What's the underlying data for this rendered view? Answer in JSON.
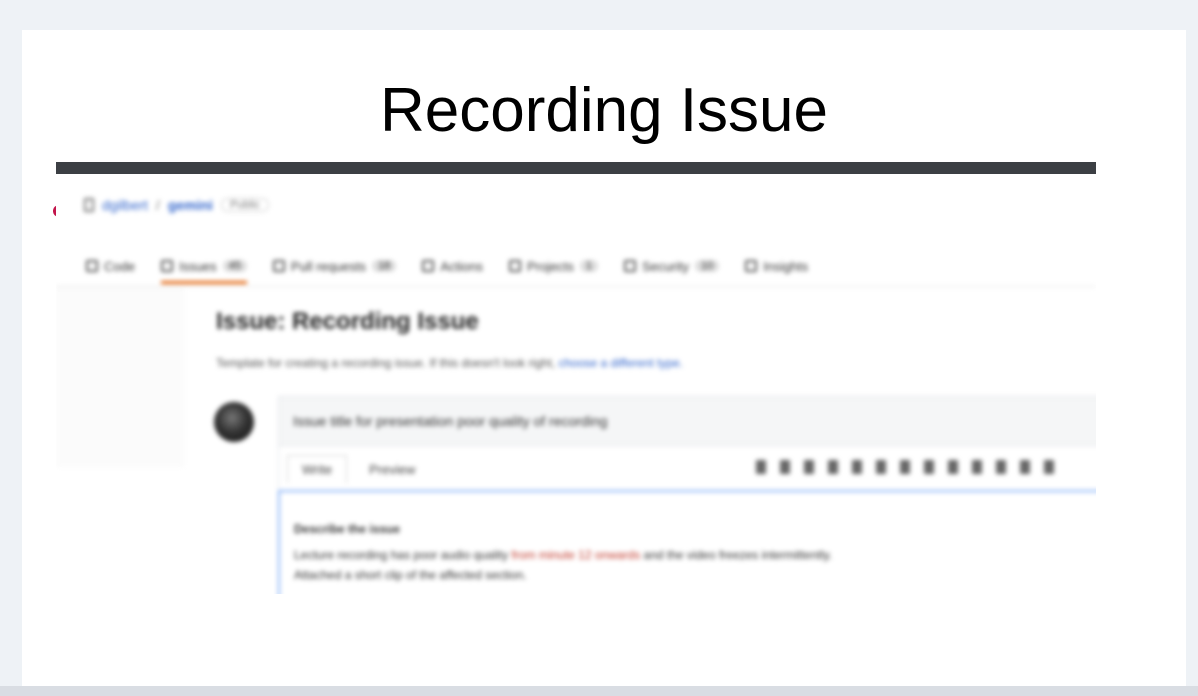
{
  "slide": {
    "title": "Recording Issue"
  },
  "screenshot": {
    "breadcrumb": {
      "owner": "dgilbert",
      "repo": "gemini",
      "visibility": "Public"
    },
    "tabs": [
      {
        "label": "Code",
        "count": ""
      },
      {
        "label": "Issues",
        "count": "45",
        "active": true
      },
      {
        "label": "Pull requests",
        "count": "18"
      },
      {
        "label": "Actions",
        "count": ""
      },
      {
        "label": "Projects",
        "count": "1"
      },
      {
        "label": "Security",
        "count": "10"
      },
      {
        "label": "Insights",
        "count": ""
      }
    ],
    "issue": {
      "title": "Issue: Recording Issue",
      "description": "Template for creating a recording issue. If this doesn't look right,",
      "description_link": "choose a different type."
    },
    "comment": {
      "header": "Issue title for presentation poor quality of recording",
      "write_tab": "Write",
      "preview_tab": "Preview",
      "body_line1": "Describe the issue",
      "body_line2_a": "Lecture recording has poor audio quality ",
      "body_line2_b": "from minute 12 onwards",
      "body_line2_c": " and the video freezes intermittently.",
      "body_line3": "Attached a short clip of the affected section."
    },
    "colors": {
      "bullet": "#c2144a",
      "active_tab_underline": "#e36209",
      "link": "#3366cc",
      "editor_focus": "#8ab4f8"
    }
  }
}
